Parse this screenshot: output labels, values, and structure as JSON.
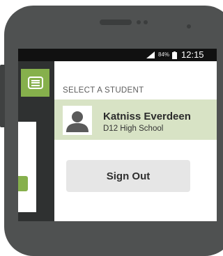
{
  "status_bar": {
    "battery_percent": "84%",
    "time": "12:15"
  },
  "drawer": {
    "section_label": "SELECT A STUDENT",
    "student": {
      "name": "Katniss Everdeen",
      "school": "D12 High School",
      "selected": true
    },
    "sign_out_label": "Sign Out"
  },
  "colors": {
    "accent_green": "#86b04c",
    "selected_row": "#d8e3c5",
    "device_frame": "#4f5151"
  },
  "icons": [
    "menu-icon",
    "signal-icon",
    "battery-icon",
    "avatar-placeholder-icon"
  ]
}
